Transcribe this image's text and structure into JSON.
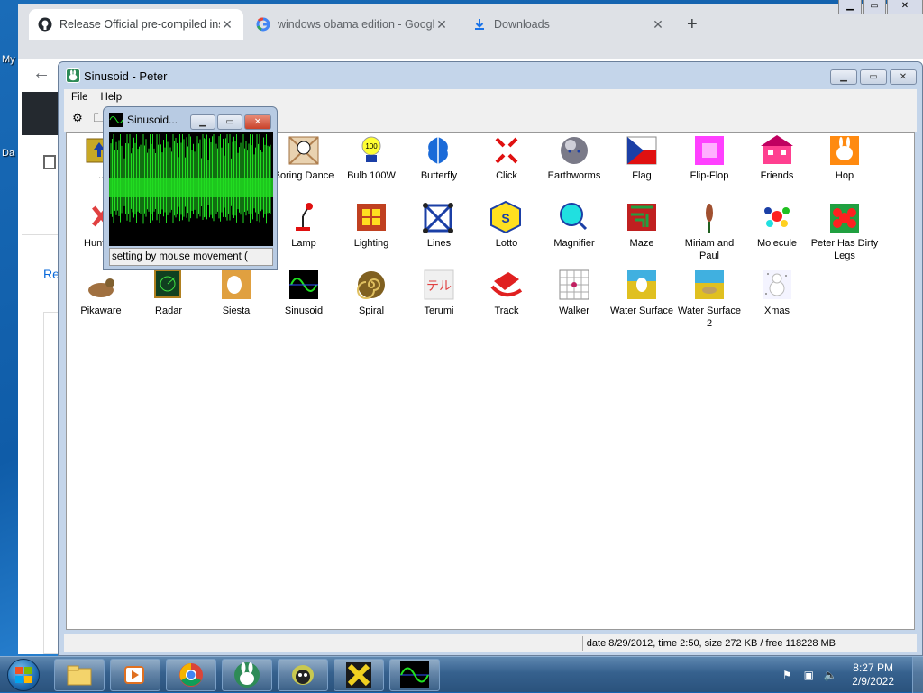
{
  "desktop": {
    "labels": [
      "My",
      "Da"
    ]
  },
  "chrome": {
    "tabs": [
      {
        "title": "Release Official pre-compiled ins",
        "icon": "github-icon"
      },
      {
        "title": "windows obama edition - Googl",
        "icon": "google-icon"
      },
      {
        "title": "Downloads",
        "icon": "download-icon"
      }
    ],
    "side_text": "Re"
  },
  "peter": {
    "title": "Sinusoid - Peter",
    "menu": [
      "File",
      "Help"
    ],
    "status": "date 8/29/2012, time 2:50, size 272 KB / free 118228 MB",
    "items": [
      {
        "label": "..",
        "icon": "folder-up-icon"
      },
      {
        "label": "Boring Dance",
        "icon": "boring-dance-icon"
      },
      {
        "label": "Bulb 100W",
        "icon": "bulb-icon"
      },
      {
        "label": "Butterfly",
        "icon": "butterfly-icon"
      },
      {
        "label": "Click",
        "icon": "click-icon"
      },
      {
        "label": "Earthworms",
        "icon": "earthworms-icon"
      },
      {
        "label": "Flag",
        "icon": "flag-icon"
      },
      {
        "label": "Flip-Flop",
        "icon": "flip-flop-icon"
      },
      {
        "label": "Friends",
        "icon": "friends-icon"
      },
      {
        "label": "Hop",
        "icon": "hop-icon"
      },
      {
        "label": "Hunting",
        "icon": "hunting-icon"
      },
      {
        "label": "Lamp",
        "icon": "lamp-icon"
      },
      {
        "label": "Lighting",
        "icon": "lighting-icon"
      },
      {
        "label": "Lines",
        "icon": "lines-icon"
      },
      {
        "label": "Lotto",
        "icon": "lotto-icon"
      },
      {
        "label": "Magnifier",
        "icon": "magnifier-icon"
      },
      {
        "label": "Maze",
        "icon": "maze-icon"
      },
      {
        "label": "Miriam and Paul",
        "icon": "miriam-paul-icon"
      },
      {
        "label": "Molecule",
        "icon": "molecule-icon"
      },
      {
        "label": "Peter Has Dirty Legs",
        "icon": "peter-dirty-legs-icon"
      },
      {
        "label": "Pikaware",
        "icon": "pikaware-icon"
      },
      {
        "label": "Radar",
        "icon": "radar-icon"
      },
      {
        "label": "Siesta",
        "icon": "siesta-icon"
      },
      {
        "label": "Sinusoid",
        "icon": "sinusoid-icon"
      },
      {
        "label": "Spiral",
        "icon": "spiral-icon"
      },
      {
        "label": "Terumi",
        "icon": "terumi-icon"
      },
      {
        "label": "Track",
        "icon": "track-icon"
      },
      {
        "label": "Walker",
        "icon": "walker-icon"
      },
      {
        "label": "Water Surface",
        "icon": "water-surface-icon"
      },
      {
        "label": "Water Surface 2",
        "icon": "water-surface-2-icon"
      },
      {
        "label": "Xmas",
        "icon": "xmas-icon"
      }
    ]
  },
  "sinusoid": {
    "title": "Sinusoid...",
    "status": "setting by mouse movement ("
  },
  "taskbar": {
    "time": "8:27 PM",
    "date": "2/9/2022",
    "buttons": [
      "explorer",
      "media-player",
      "chrome",
      "peter-rabbit",
      "alien",
      "x-app",
      "sinusoid"
    ]
  },
  "colors": {
    "wave": "#22dd22",
    "taskbar": "#36618e",
    "title": "#c4d5ea"
  }
}
